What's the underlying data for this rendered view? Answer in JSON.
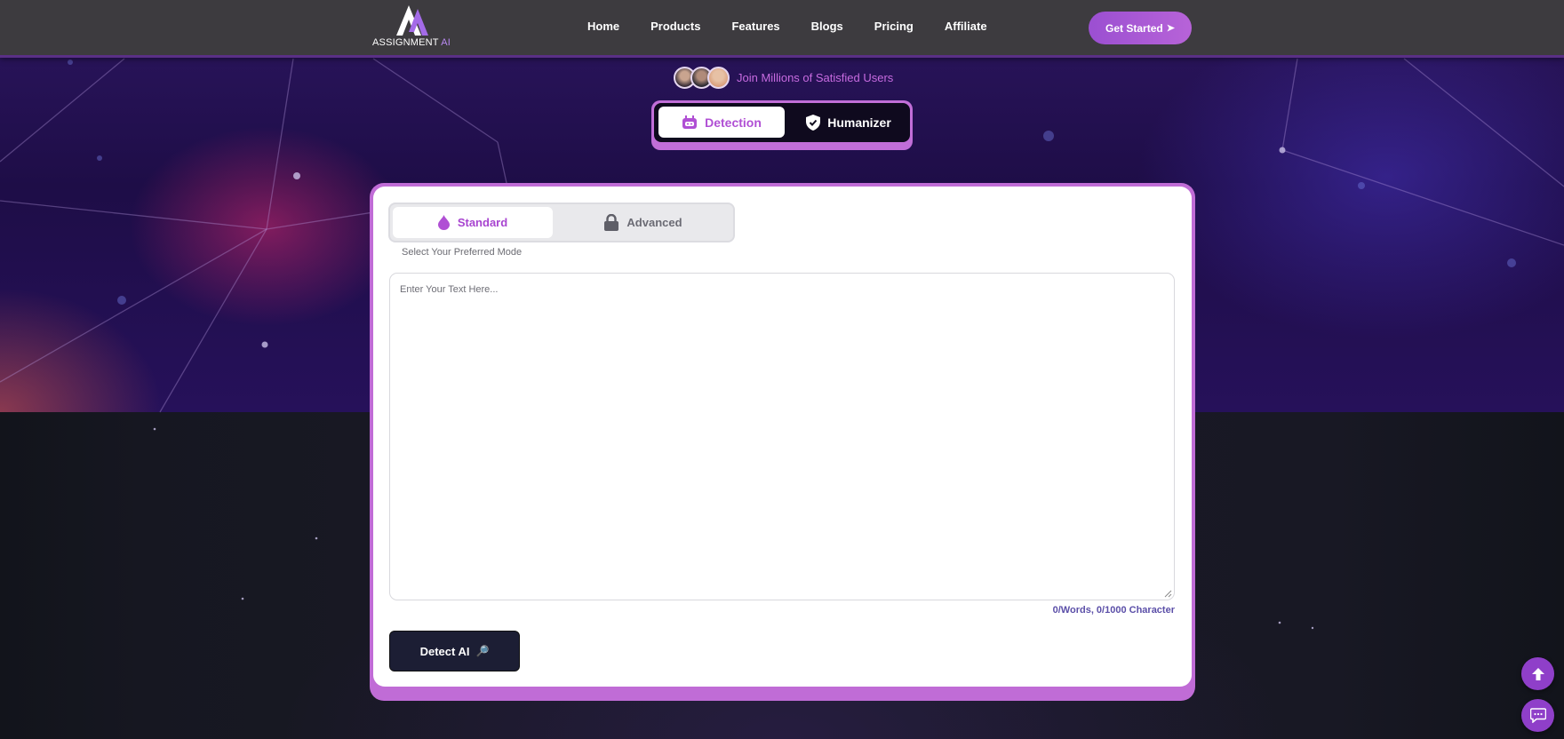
{
  "brand": {
    "name": "ASSIGNMENT",
    "name_suffix": "AI",
    "colors": {
      "primary": "#b763d8",
      "accent": "#a845d0",
      "dark": "#1c1e34"
    }
  },
  "nav": {
    "links": [
      "Home",
      "Products",
      "Features",
      "Blogs",
      "Pricing",
      "Affiliate"
    ],
    "cta_label": "Get Started",
    "cta_icon": "send-arrow-icon"
  },
  "social_proof": {
    "text": "Join Millions of Satisfied Users"
  },
  "mode_toggle": {
    "detection_label": "Detection",
    "detection_icon": "robot-icon",
    "humanizer_label": "Humanizer",
    "humanizer_icon": "shield-check-icon",
    "selected": "Detection"
  },
  "detector": {
    "modes": {
      "standard_label": "Standard",
      "standard_icon": "drop-icon",
      "advanced_label": "Advanced",
      "advanced_icon": "lock-icon",
      "selected": "Standard"
    },
    "mode_hint": "Select Your Preferred Mode",
    "input": {
      "value": "",
      "placeholder": "Enter Your Text Here..."
    },
    "counter": "0/Words, 0/1000 Character",
    "submit_label": "Detect AI",
    "submit_icon": "magnifier-icon"
  },
  "floating": {
    "scroll_top_icon": "arrow-up-icon",
    "chat_icon": "chat-icon"
  }
}
